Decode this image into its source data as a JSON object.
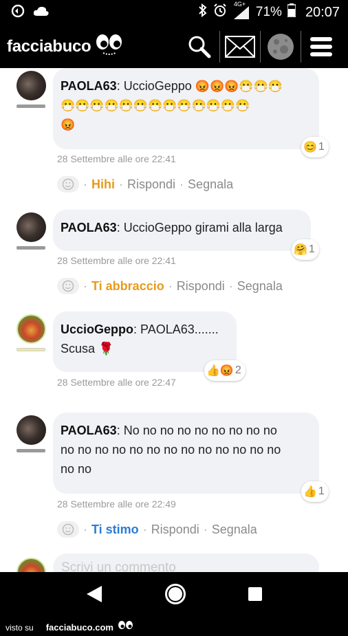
{
  "status_bar": {
    "network": "4G+",
    "battery": "71%",
    "time": "20:07"
  },
  "header": {
    "logo": "facciabuco"
  },
  "comments": [
    {
      "author": "PAOLA63",
      "text": "UccioGeppo",
      "emoji_line1": "😡😡😡😷😷😷",
      "emoji_line2": "😷😷😷😷😷😷😷😷😷😷😷😷😷",
      "emoji_line3": "😡",
      "reaction_emoji": "😊",
      "reaction_count": "1",
      "timestamp": "28 Settembre alle ore 22:41",
      "reaction_label": "Hihi",
      "reaction_label_color": "#e79b1b",
      "reply": "Rispondi",
      "report": "Segnala"
    },
    {
      "author": "PAOLA63",
      "text": "UccioGeppo girami alla larga",
      "reaction_emoji": "🤗",
      "reaction_count": "1",
      "timestamp": "28 Settembre alle ore 22:41",
      "reaction_label": "Ti abbraccio",
      "reaction_label_color": "#e79b1b",
      "reply": "Rispondi",
      "report": "Segnala"
    },
    {
      "author": "UccioGeppo",
      "text": "PAOLA63.......",
      "line2": "Scusa 🌹",
      "reaction_emoji": "👍😡",
      "reaction_count": "2",
      "timestamp": "28 Settembre alle ore 22:47"
    },
    {
      "author": "PAOLA63",
      "text": "No no no no no no no no no",
      "line2": "no no no no no no no no no no no no no",
      "line3": "no no",
      "reaction_emoji": "👍",
      "reaction_count": "1",
      "timestamp": "28 Settembre alle ore 22:49",
      "reaction_label": "Ti stimo",
      "reaction_label_color": "#2b7bd6",
      "reply": "Rispondi",
      "report": "Segnala"
    }
  ],
  "comment_input": {
    "placeholder": "Scrivi un commento"
  },
  "footer": {
    "visto_su": "visto su",
    "site": "facciabuco.com"
  },
  "colors": {
    "bubble": "#f1f2f6",
    "header_bg": "#000000"
  }
}
